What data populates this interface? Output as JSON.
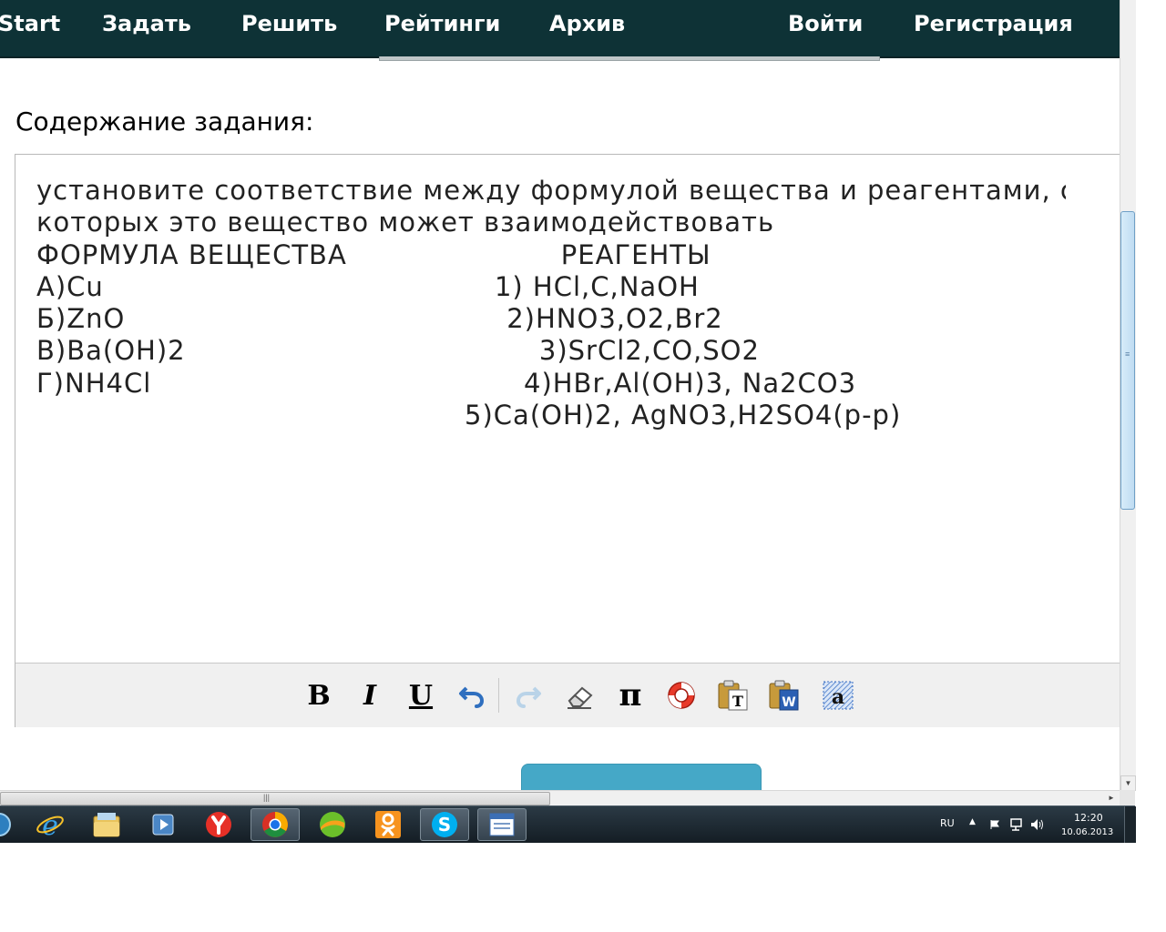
{
  "nav": {
    "items": [
      "Start",
      "Задать",
      "Решить",
      "Рейтинги",
      "Архив"
    ],
    "login": "Войти",
    "register": "Регистрация"
  },
  "task": {
    "section_title": "Содержание задания:",
    "lines": [
      "установите соответствие между формулой вещества и реагентами, с",
      "которых это вещество может взаимодействовать",
      "ФОРМУЛА ВЕЩЕСТВА                       РЕАГЕНТЫ",
      "А)Cu                                          1) HCl,C,NaOH",
      "Б)ZnO                                         2)HNO3,O2,Br2",
      "В)Ba(OH)2                                      3)SrCl2,CO,SO2",
      "Г)NH4Cl                                        4)HBr,Al(OH)3, Na2CO3",
      "                                              5)Ca(OH)2, AgNO3,H2SO4(р-р)"
    ]
  },
  "toolbar": {
    "bold": "B",
    "italic": "I",
    "underline": "U",
    "pi": "π",
    "paste_text_letter": "T",
    "paste_word_letter": "W",
    "select_all_letter": "a",
    "icons": [
      "bold-icon",
      "italic-icon",
      "underline-icon",
      "undo-icon",
      "redo-icon",
      "eraser-icon",
      "pi-icon",
      "help-lifebuoy-icon",
      "paste-text-icon",
      "paste-word-icon",
      "select-all-icon"
    ]
  },
  "taskbar": {
    "apps": [
      "windows-media-icon",
      "internet-explorer-icon",
      "file-explorer-icon",
      "media-player-icon",
      "yandex-browser-icon",
      "chrome-icon",
      "mail-agent-icon",
      "odnoklassniki-icon",
      "skype-icon",
      "word-document-icon"
    ],
    "active_app": "chrome-icon",
    "language": "RU",
    "time": "12:20",
    "date": "10.06.2013"
  },
  "colors": {
    "nav_bg": "#0e3236",
    "submit_bg": "#45a8c7",
    "toolbar_bg": "#f0f0f0"
  }
}
